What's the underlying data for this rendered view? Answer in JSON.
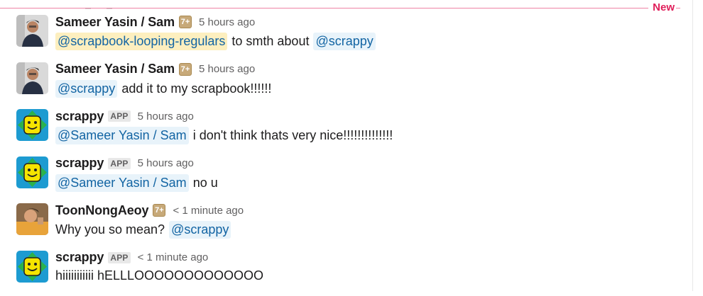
{
  "divider": {
    "label": "New"
  },
  "messages": [
    {
      "author": "Sameer Yasin / Sam",
      "badge": "7+",
      "time": "5 hours ago",
      "avatar": "person-avatar",
      "parts": [
        {
          "type": "group-mention",
          "text": "@scrapbook-looping-regulars"
        },
        {
          "type": "text",
          "text": "to smth about"
        },
        {
          "type": "mention",
          "text": "@scrappy"
        }
      ]
    },
    {
      "author": "Sameer Yasin / Sam",
      "badge": "7+",
      "time": "5 hours ago",
      "avatar": "person-avatar",
      "parts": [
        {
          "type": "mention",
          "text": "@scrappy"
        },
        {
          "type": "text",
          "text": "add it to my scrapbook!!!!!!"
        }
      ]
    },
    {
      "author": "scrappy",
      "app_badge": "APP",
      "time": "5 hours ago",
      "avatar": "scrappy-bot-avatar",
      "parts": [
        {
          "type": "mention",
          "text": "@Sameer Yasin / Sam"
        },
        {
          "type": "text",
          "text": "i don't think thats very nice!!!!!!!!!!!!!!"
        }
      ]
    },
    {
      "author": "scrappy",
      "app_badge": "APP",
      "time": "5 hours ago",
      "avatar": "scrappy-bot-avatar",
      "parts": [
        {
          "type": "mention",
          "text": "@Sameer Yasin / Sam"
        },
        {
          "type": "text",
          "text": "no u"
        }
      ]
    },
    {
      "author": "ToonNongAeoy",
      "badge": "7+",
      "time": "< 1 minute ago",
      "avatar": "person-avatar",
      "parts": [
        {
          "type": "text",
          "text": "Why you so mean?"
        },
        {
          "type": "mention",
          "text": "@scrappy"
        }
      ]
    },
    {
      "author": "scrappy",
      "app_badge": "APP",
      "time": "< 1 minute ago",
      "avatar": "scrappy-bot-avatar",
      "parts": [
        {
          "type": "text",
          "text": "hiiiiiiiiiii hELLLOOOOOOOOOOOOO"
        }
      ]
    }
  ],
  "colors": {
    "new_divider": "#e01e5a",
    "mention_bg": "#e8f3fa",
    "mention_text": "#1264a3",
    "group_mention_bg": "#fdefbf",
    "bot_bg": "#1d9bd1",
    "bot_face": "#f5e400",
    "bot_arrows": "#2bb24c"
  }
}
